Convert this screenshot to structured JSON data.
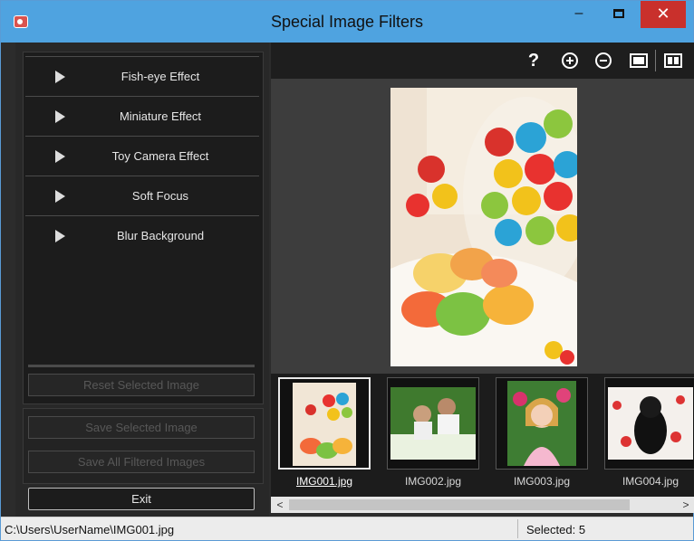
{
  "window": {
    "title": "Special Image Filters",
    "minimize": "–",
    "close": "✕"
  },
  "effects": [
    {
      "label": "Fish-eye Effect"
    },
    {
      "label": "Miniature Effect"
    },
    {
      "label": "Toy Camera Effect"
    },
    {
      "label": "Soft Focus"
    },
    {
      "label": "Blur Background"
    }
  ],
  "buttons": {
    "reset": "Reset Selected Image",
    "save_selected": "Save Selected Image",
    "save_all": "Save All Filtered Images",
    "exit": "Exit"
  },
  "toolbar": {
    "help": "?"
  },
  "thumbnails": [
    {
      "name": "IMG001.jpg",
      "selected": true
    },
    {
      "name": "IMG002.jpg",
      "selected": false
    },
    {
      "name": "IMG003.jpg",
      "selected": false
    },
    {
      "name": "IMG004.jpg",
      "selected": false
    }
  ],
  "scroll": {
    "left": "<",
    "right": ">"
  },
  "status": {
    "path": "C:\\Users\\UserName\\IMG001.jpg",
    "selected": "Selected: 5"
  }
}
